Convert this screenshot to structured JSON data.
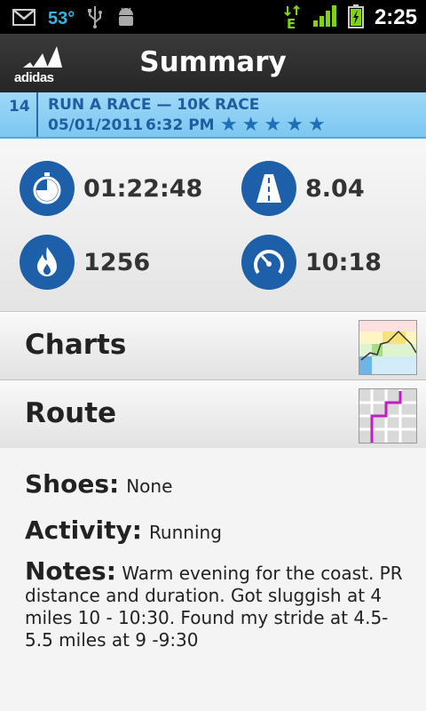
{
  "status_bar": {
    "temperature": "53°",
    "network_type": "E",
    "time": "2:25"
  },
  "header": {
    "brand": "adidas",
    "title": "Summary"
  },
  "workout": {
    "number": "14",
    "title": "RUN A RACE — 10K RACE",
    "date": "05/01/2011",
    "time": "6:32 PM",
    "rating": 5
  },
  "stats": {
    "duration": "01:22:48",
    "distance": "8.04",
    "calories": "1256",
    "pace": "10:18"
  },
  "rows": {
    "charts_label": "Charts",
    "route_label": "Route"
  },
  "details": {
    "shoes_label": "Shoes:",
    "shoes_value": "None",
    "activity_label": "Activity:",
    "activity_value": "Running",
    "notes_label": "Notes:",
    "notes_value": "Warm evening for the coast. PR distance and duration.  Got sluggish at 4 miles 10 - 10:30. Found my stride at 4.5-5.5 miles at 9 -9:30"
  },
  "colors": {
    "accent_blue": "#1d5fa8",
    "race_bar": "#8ccff4",
    "status_blue": "#33b5e5"
  }
}
